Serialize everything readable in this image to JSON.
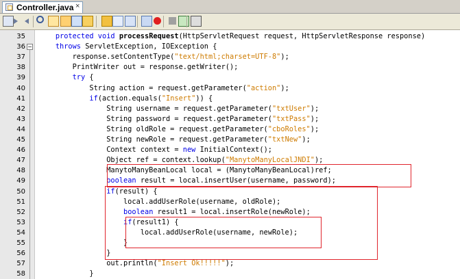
{
  "tab": {
    "title": "Controller.java",
    "close": "×"
  },
  "toolbar": {
    "icons": [
      "source-icon",
      "back-icon",
      "forward-icon",
      "find-icon",
      "prev-occurrence-icon",
      "next-occurrence-icon",
      "toggle-highlight-icon",
      "prev-bookmark-icon",
      "next-bookmark-icon",
      "toggle-bookmark-icon",
      "shift-left-icon",
      "shift-right-icon",
      "record-macro-icon",
      "stop-macro-icon",
      "comment-icon",
      "uncomment-icon"
    ]
  },
  "code": {
    "lines": [
      {
        "n": "35",
        "tokens": [
          [
            "",
            "    "
          ],
          [
            "k",
            "protected void "
          ],
          [
            "b",
            "processRequest"
          ],
          [
            "",
            "(HttpServletRequest request, HttpServletResponse response)"
          ]
        ]
      },
      {
        "n": "36",
        "tokens": [
          [
            "",
            "    "
          ],
          [
            "k",
            "throws "
          ],
          [
            "",
            "ServletException, IOException {"
          ]
        ]
      },
      {
        "n": "37",
        "tokens": [
          [
            "",
            "        response.setContentType("
          ],
          [
            "s",
            "\"text/html;charset=UTF-8\""
          ],
          [
            "",
            ");"
          ]
        ]
      },
      {
        "n": "38",
        "tokens": [
          [
            "",
            "        PrintWriter out = response.getWriter();"
          ]
        ]
      },
      {
        "n": "39",
        "tokens": [
          [
            "",
            "        "
          ],
          [
            "k",
            "try "
          ],
          [
            "",
            "{"
          ]
        ]
      },
      {
        "n": "40",
        "tokens": [
          [
            "",
            "            String action = request.getParameter("
          ],
          [
            "s",
            "\"action\""
          ],
          [
            "",
            ");"
          ]
        ]
      },
      {
        "n": "41",
        "tokens": [
          [
            "",
            "            "
          ],
          [
            "k",
            "if"
          ],
          [
            "",
            "(action.equals("
          ],
          [
            "s",
            "\"Insert\""
          ],
          [
            "",
            ")) {"
          ]
        ]
      },
      {
        "n": "42",
        "tokens": [
          [
            "",
            "                String username = request.getParameter("
          ],
          [
            "s",
            "\"txtUser\""
          ],
          [
            "",
            ");"
          ]
        ]
      },
      {
        "n": "43",
        "tokens": [
          [
            "",
            "                String password = request.getParameter("
          ],
          [
            "s",
            "\"txtPass\""
          ],
          [
            "",
            ");"
          ]
        ]
      },
      {
        "n": "44",
        "tokens": [
          [
            "",
            "                String oldRole = request.getParameter("
          ],
          [
            "s",
            "\"cboRoles\""
          ],
          [
            "",
            ");"
          ]
        ]
      },
      {
        "n": "45",
        "tokens": [
          [
            "",
            "                String newRole = request.getParameter("
          ],
          [
            "s",
            "\"txtNew\""
          ],
          [
            "",
            ");"
          ]
        ]
      },
      {
        "n": "46",
        "tokens": [
          [
            "",
            "                Context context = "
          ],
          [
            "k",
            "new "
          ],
          [
            "",
            "InitialContext();"
          ]
        ]
      },
      {
        "n": "47",
        "tokens": [
          [
            "",
            "                Object ref = context.lookup("
          ],
          [
            "s",
            "\"ManytoManyLocalJNDI\""
          ],
          [
            "",
            ");"
          ]
        ]
      },
      {
        "n": "48",
        "tokens": [
          [
            "",
            "                ManytoManyBeanLocal local = (ManytoManyBeanLocal)ref;"
          ]
        ]
      },
      {
        "n": "49",
        "tokens": [
          [
            "",
            "                "
          ],
          [
            "k",
            "boolean "
          ],
          [
            "",
            "result = local.insertUser(username, password);"
          ]
        ]
      },
      {
        "n": "50",
        "tokens": [
          [
            "",
            "                "
          ],
          [
            "k",
            "if"
          ],
          [
            "",
            "(result) {"
          ]
        ]
      },
      {
        "n": "51",
        "tokens": [
          [
            "",
            "                    local.addUserRole(username, oldRole);"
          ]
        ]
      },
      {
        "n": "52",
        "tokens": [
          [
            "",
            "                    "
          ],
          [
            "k",
            "boolean "
          ],
          [
            "",
            "result1 = local.insertRole(newRole);"
          ]
        ]
      },
      {
        "n": "53",
        "tokens": [
          [
            "",
            "                    "
          ],
          [
            "k",
            "if"
          ],
          [
            "",
            "(result1) {"
          ]
        ]
      },
      {
        "n": "54",
        "tokens": [
          [
            "",
            "                        local.addUserRole(username, newRole);"
          ]
        ]
      },
      {
        "n": "55",
        "tokens": [
          [
            "",
            "                    }"
          ]
        ]
      },
      {
        "n": "56",
        "tokens": [
          [
            "",
            "                }"
          ]
        ]
      },
      {
        "n": "57",
        "tokens": [
          [
            "",
            "                out.println("
          ],
          [
            "s",
            "\"Insert Ok!!!!!\""
          ],
          [
            "",
            ");"
          ]
        ]
      },
      {
        "n": "58",
        "tokens": [
          [
            "",
            "            }"
          ]
        ]
      }
    ]
  }
}
